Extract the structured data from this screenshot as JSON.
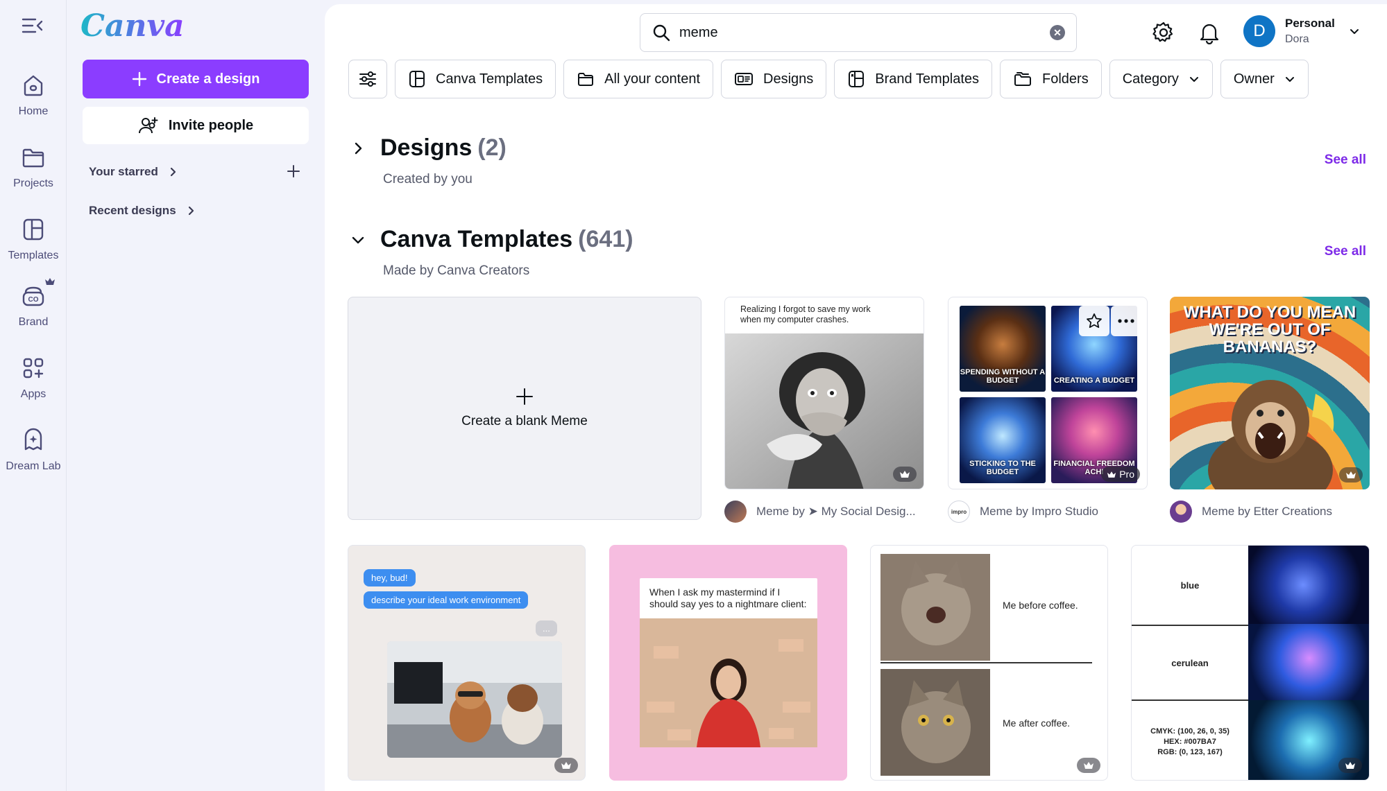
{
  "rail": {
    "items": [
      {
        "label": "Home"
      },
      {
        "label": "Projects"
      },
      {
        "label": "Templates"
      },
      {
        "label": "Brand"
      },
      {
        "label": "Apps"
      },
      {
        "label": "Dream Lab"
      }
    ]
  },
  "panel": {
    "logo": "Canva",
    "create_label": "Create a design",
    "invite_label": "Invite people",
    "starred_label": "Your starred",
    "recent_label": "Recent designs"
  },
  "header": {
    "search_value": "meme",
    "account_name": "Personal",
    "account_sub": "Dora",
    "avatar_initial": "D"
  },
  "filters": [
    "Canva Templates",
    "All your content",
    "Designs",
    "Brand Templates",
    "Folders",
    "Category",
    "Owner"
  ],
  "sections": {
    "designs": {
      "title": "Designs",
      "count": "(2)",
      "subtitle": "Created by you",
      "see_all": "See all"
    },
    "templates": {
      "title": "Canva Templates",
      "count": "(641)",
      "subtitle": "Made by Canva Creators",
      "see_all": "See all"
    }
  },
  "blank_card": {
    "label": "Create a blank Meme"
  },
  "templates_row1": [
    {
      "caption": "Realizing I forgot to save my work when my computer crashes.",
      "creator": "Meme by ➤ My Social Desig..."
    },
    {
      "tiles": [
        "SPENDING WITHOUT A BUDGET",
        "CREATING A BUDGET",
        "STICKING TO THE BUDGET",
        "FINANCIAL FREEDOM ACHI"
      ],
      "badge": "Pro",
      "creator": "Meme by Impro Studio",
      "creator_logo": "impro"
    },
    {
      "headline": "WHAT DO YOU MEAN WE'RE OUT OF BANANAS?",
      "creator": "Meme by Etter Creations"
    }
  ],
  "templates_row2": [
    {
      "bubble1": "hey, bud!",
      "bubble2": "describe your ideal work environment",
      "bubble3": "..."
    },
    {
      "caption": "When I ask my mastermind if I should say yes to a nightmare client:"
    },
    {
      "line1": "Me before coffee.",
      "line2": "Me after coffee."
    },
    {
      "labels": [
        "blue",
        "cerulean",
        "CMYK: (100, 26, 0, 35)",
        "HEX: #007BA7",
        "RGB: (0, 123, 167)"
      ]
    }
  ],
  "colors": {
    "accent": "#8b3dff",
    "link": "#7d2ae8",
    "avatar": "#0f74c5"
  }
}
